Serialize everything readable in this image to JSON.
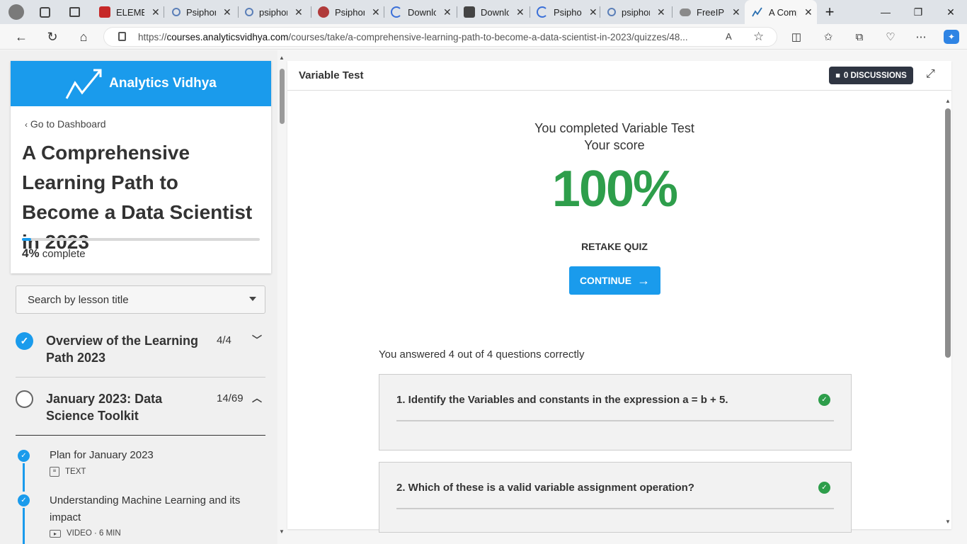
{
  "browser": {
    "tabs": [
      {
        "title": "",
        "icon": "profile-icon"
      },
      {
        "title": "",
        "icon": "workspaces-icon"
      },
      {
        "title": "",
        "icon": "tab-actions-icon"
      },
      {
        "title": "ELEMEN",
        "icon": "pdf-icon"
      },
      {
        "title": "Psiphon",
        "icon": "search-icon"
      },
      {
        "title": "psiphon",
        "icon": "search-icon"
      },
      {
        "title": "Psiphon",
        "icon": "p-logo-icon"
      },
      {
        "title": "Downlo",
        "icon": "loading-icon"
      },
      {
        "title": "Downlo",
        "icon": "dark-page-icon"
      },
      {
        "title": "Psiphon",
        "icon": "loading-icon"
      },
      {
        "title": "psiphon",
        "icon": "search-icon"
      },
      {
        "title": "FreeIP",
        "icon": "cloud-icon"
      },
      {
        "title": "A Comp",
        "icon": "av-logo-icon"
      }
    ],
    "url_prefix": "https://",
    "url_domain": "courses.analyticsvidhya.com",
    "url_path": "/courses/take/a-comprehensive-learning-path-to-become-a-data-scientist-in-2023/quizzes/48..."
  },
  "sidebar": {
    "brand": "Analytics Vidhya",
    "back_link": "Go to Dashboard",
    "course_title": "A Comprehensive Learning Path to Become a Data Scientist in 2023",
    "progress_value": "4%",
    "progress_label": "complete",
    "progress_fraction": 0.04,
    "search_placeholder": "Search by lesson title",
    "sections": [
      {
        "title": "Overview of the Learning Path 2023",
        "count": "4/4",
        "done": true,
        "expanded": false
      },
      {
        "title": "January 2023: Data Science Toolkit",
        "count": "14/69",
        "done": false,
        "expanded": true
      }
    ],
    "lessons": [
      {
        "title": "Plan for January 2023",
        "meta": "TEXT",
        "icon": "text-doc-icon"
      },
      {
        "title": "Understanding Machine Learning and its impact",
        "meta": "VIDEO · 6 MIN",
        "icon": "video-icon"
      }
    ]
  },
  "main": {
    "title": "Variable Test",
    "discussions": "0 DISCUSSIONS",
    "completed_line": "You completed Variable Test",
    "score_label": "Your score",
    "score": "100%",
    "retake": "RETAKE QUIZ",
    "continue": "CONTINUE",
    "answered": "You answered 4 out of 4 questions correctly",
    "questions": [
      {
        "text": "1. Identify the Variables and constants in the expression a = b + 5.",
        "correct": true
      },
      {
        "text": "2. Which of these is a valid variable assignment operation?",
        "correct": true
      }
    ]
  },
  "colors": {
    "accent": "#1a9bec",
    "success": "#2e9e4b",
    "dark": "#2f3542"
  }
}
